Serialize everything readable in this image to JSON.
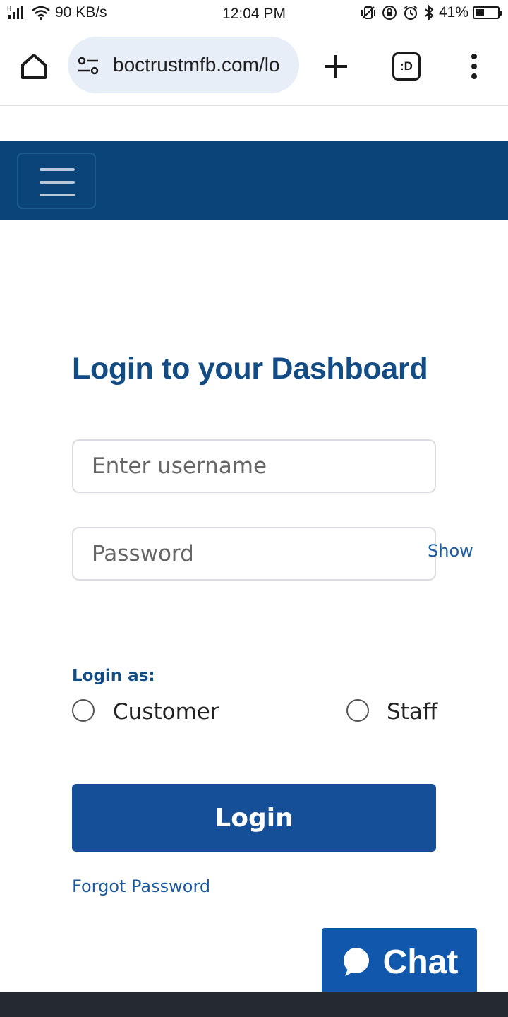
{
  "status_bar": {
    "network_speed": "90 KB/s",
    "time": "12:04 PM",
    "battery": "41%",
    "battery_level": 0.41,
    "icons": [
      "signal-icon",
      "wifi-icon",
      "vibrate-icon",
      "rotation-lock-icon",
      "alarm-icon",
      "bluetooth-icon",
      "battery-icon"
    ]
  },
  "browser": {
    "url": "boctrustmfb.com/lo",
    "tab_count_label": ":D",
    "icons": [
      "home-icon",
      "site-settings-icon",
      "plus-icon",
      "tabs-icon",
      "more-vert-icon"
    ]
  },
  "nav": {
    "colors": {
      "bar": "#0b4479",
      "toggler_border": "#1e5b93"
    }
  },
  "login": {
    "title": "Login to your Dashboard",
    "username_placeholder": "Enter username",
    "password_placeholder": "Password",
    "show_label": "Show",
    "login_as_label": "Login as:",
    "options": [
      "Customer",
      "Staff"
    ],
    "submit_label": "Login",
    "forgot_label": "Forgot Password",
    "colors": {
      "title": "#134b84",
      "button": "#154f97",
      "link": "#1c5aa0"
    }
  },
  "chat": {
    "label": "Chat",
    "color": "#1158ad"
  }
}
